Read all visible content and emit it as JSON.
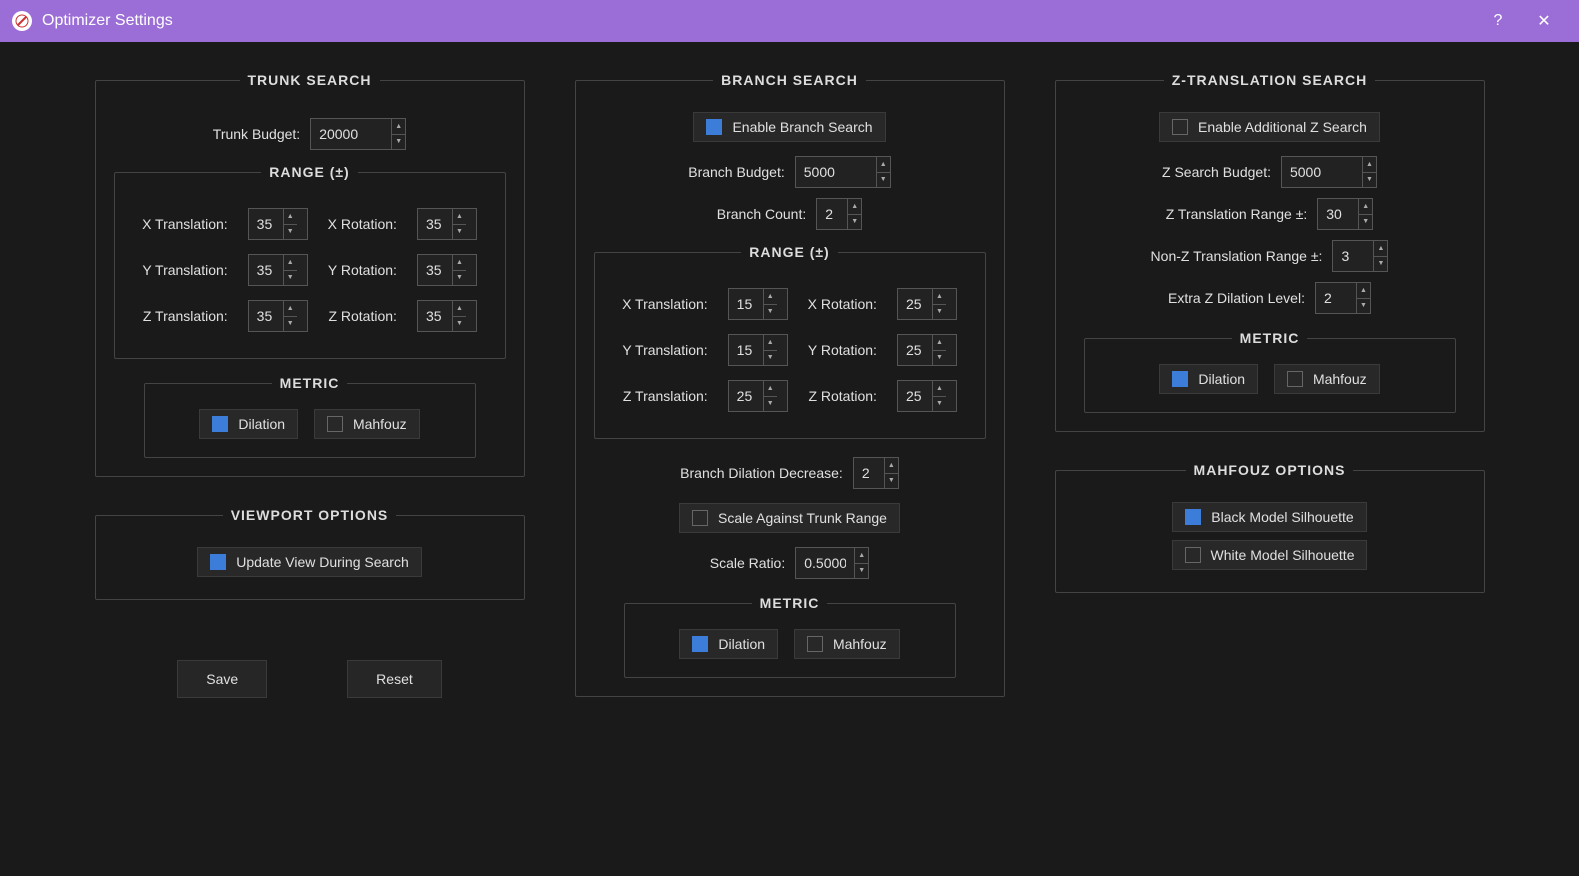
{
  "window": {
    "title": "Optimizer Settings",
    "help": "?",
    "close": "✕"
  },
  "trunk": {
    "title": "TRUNK SEARCH",
    "budget_label": "Trunk Budget:",
    "budget": "20000",
    "range_title": "RANGE (±)",
    "xt_label": "X Translation:",
    "xt": "35",
    "xr_label": "X Rotation:",
    "xr": "35",
    "yt_label": "Y Translation:",
    "yt": "35",
    "yr_label": "Y Rotation:",
    "yr": "35",
    "zt_label": "Z Translation:",
    "zt": "35",
    "zr_label": "Z Rotation:",
    "zr": "35",
    "metric_title": "METRIC",
    "dilation": "Dilation",
    "mahfouz": "Mahfouz"
  },
  "viewport": {
    "title": "VIEWPORT OPTIONS",
    "update_label": "Update View During Search"
  },
  "buttons": {
    "save": "Save",
    "reset": "Reset"
  },
  "branch": {
    "title": "BRANCH SEARCH",
    "enable_label": "Enable Branch Search",
    "budget_label": "Branch Budget:",
    "budget": "5000",
    "count_label": "Branch Count:",
    "count": "2",
    "range_title": "RANGE (±)",
    "xt_label": "X Translation:",
    "xt": "15",
    "xr_label": "X Rotation:",
    "xr": "25",
    "yt_label": "Y Translation:",
    "yt": "15",
    "yr_label": "Y Rotation:",
    "yr": "25",
    "zt_label": "Z Translation:",
    "zt": "25",
    "zr_label": "Z Rotation:",
    "zr": "25",
    "dilation_dec_label": "Branch Dilation Decrease:",
    "dilation_dec": "2",
    "scale_against_label": "Scale Against Trunk Range",
    "scale_ratio_label": "Scale Ratio:",
    "scale_ratio": "0.5000",
    "metric_title": "METRIC",
    "dilation": "Dilation",
    "mahfouz": "Mahfouz"
  },
  "zsearch": {
    "title": "Z-TRANSLATION SEARCH",
    "enable_label": "Enable Additional Z Search",
    "budget_label": "Z Search Budget:",
    "budget": "5000",
    "zt_range_label": "Z Translation Range ±:",
    "zt_range": "30",
    "nonz_range_label": "Non-Z Translation Range ±:",
    "nonz_range": "3",
    "extra_dil_label": "Extra Z Dilation Level:",
    "extra_dil": "2",
    "metric_title": "METRIC",
    "dilation": "Dilation",
    "mahfouz": "Mahfouz"
  },
  "mahfouz_opts": {
    "title": "MAHFOUZ OPTIONS",
    "black_label": "Black Model Silhouette",
    "white_label": "White Model Silhouette"
  }
}
